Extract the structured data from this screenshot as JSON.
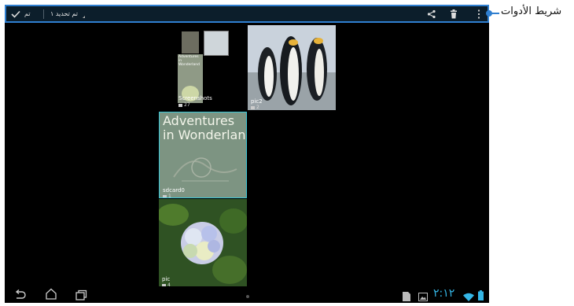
{
  "toolbar": {
    "done_label": "تم",
    "selection_label": "تم تحديد ١"
  },
  "albums": [
    {
      "name": "Screenshots",
      "count": "27"
    },
    {
      "name": "pic2",
      "count": "2"
    },
    {
      "name": "sdcard0",
      "count": "1"
    },
    {
      "name": "pic",
      "count": "4"
    }
  ],
  "thumb_text": {
    "small": "Adventures in Wonderland",
    "large_line1": "Adventures",
    "large_line2": "in Wonderland"
  },
  "status": {
    "time": "٢:١٢"
  },
  "callout": {
    "label": "شريط الأدوات"
  },
  "icons": [
    "check-icon",
    "share-icon",
    "trash-icon",
    "overflow-menu-icon",
    "back-icon",
    "home-icon",
    "recent-apps-icon",
    "sd-card-icon",
    "gallery-icon",
    "wifi-icon",
    "battery-icon",
    "folder-icon"
  ],
  "colors": {
    "toolbar_border": "#2f7fd0",
    "toolbar_bg": "#0c1e2b",
    "selection": "#39c6d6",
    "clock": "#35b6e6"
  }
}
